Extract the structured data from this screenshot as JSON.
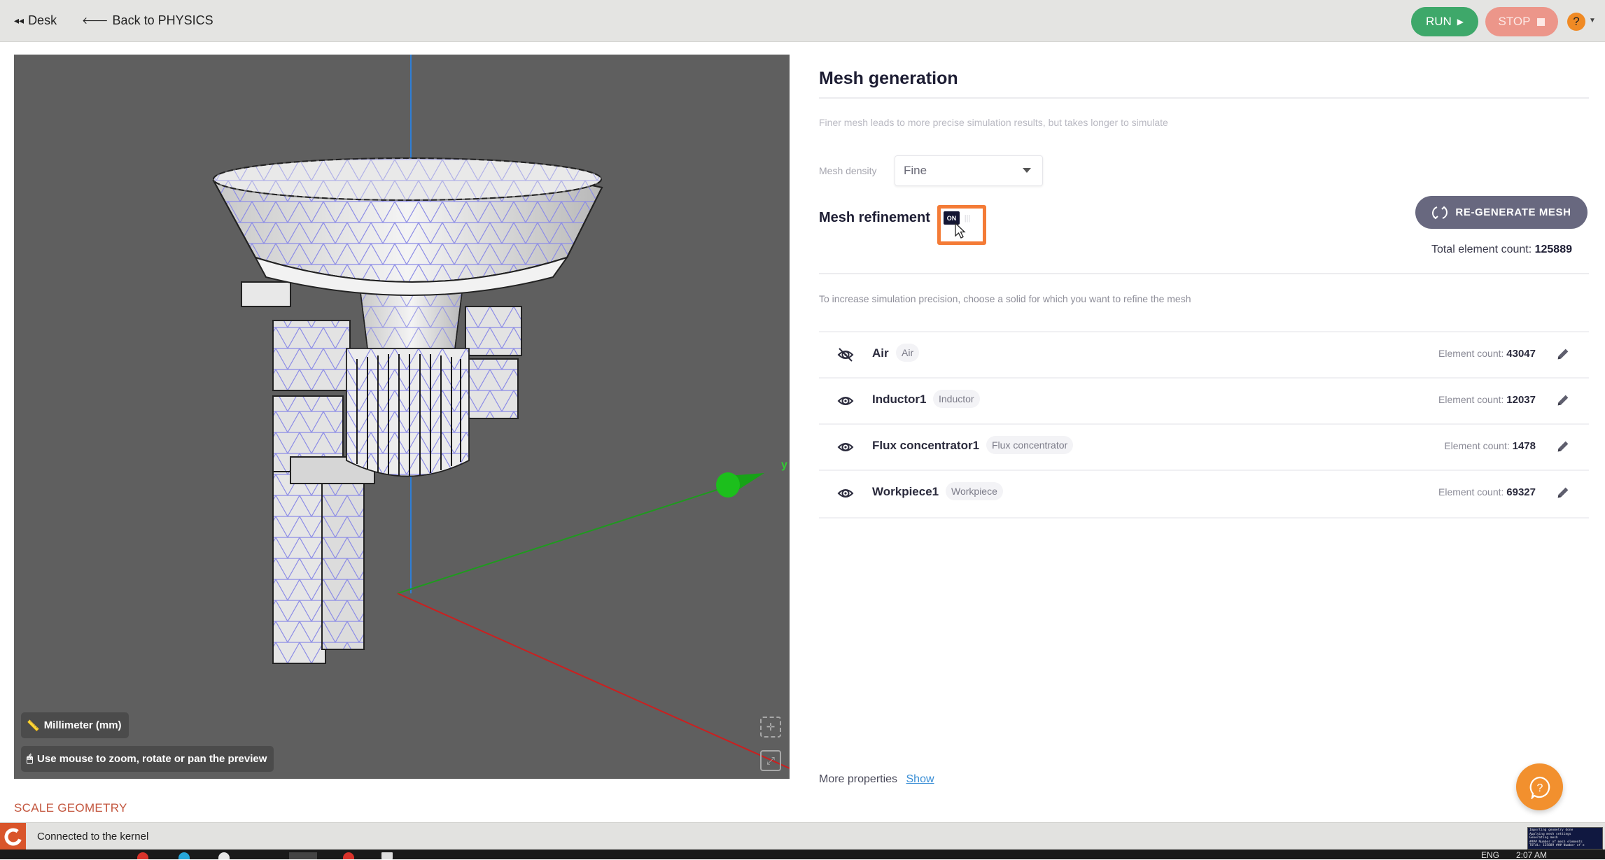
{
  "topbar": {
    "desk_label": "Desk",
    "back_label": "Back to PHYSICS",
    "run_label": "RUN",
    "stop_label": "STOP",
    "help_label": "?"
  },
  "viewport": {
    "units_label": "Millimeter (mm)",
    "hint_label": "Use mouse to zoom, rotate or pan the preview",
    "axis_y_label": "y",
    "axis_colors": {
      "x": "#cc1f1f",
      "y": "#1f9a1f",
      "z": "#2f7fd6"
    },
    "mesh_line_color": "#8c8ce6"
  },
  "scale_geometry_label": "SCALE GEOMETRY",
  "panel": {
    "title": "Mesh generation",
    "description": "Finer mesh leads to more precise simulation results, but takes longer to simulate",
    "density_label": "Mesh density",
    "density_value": "Fine",
    "refinement_label": "Mesh refinement",
    "refinement_toggle": {
      "state": "ON",
      "on_label": "ON",
      "off_label": "|||"
    },
    "regenerate_label": "RE-GENERATE MESH",
    "total_count_label": "Total element count:",
    "total_count_value": "125889",
    "refine_hint": "To increase simulation precision, choose a solid for which you want to refine the mesh",
    "count_label": "Element count:",
    "solids": [
      {
        "name": "Air",
        "tag": "Air",
        "count": "43047",
        "visible": false
      },
      {
        "name": "Inductor1",
        "tag": "Inductor",
        "count": "12037",
        "visible": true
      },
      {
        "name": "Flux concentrator1",
        "tag": "Flux concentrator",
        "count": "1478",
        "visible": true
      },
      {
        "name": "Workpiece1",
        "tag": "Workpiece",
        "count": "69327",
        "visible": true
      }
    ],
    "more_properties_label": "More properties",
    "show_label": "Show"
  },
  "statusbar": {
    "status_text": "Connected to the kernel",
    "console_lines": [
      "Importing geometry done",
      "Applying mesh settings",
      "Generating mesh",
      "#### Number of mesh elements",
      "TOTAL: 125889 ### Number of e"
    ]
  },
  "taskbar": {
    "language": "ENG",
    "time": "2:07 AM"
  }
}
